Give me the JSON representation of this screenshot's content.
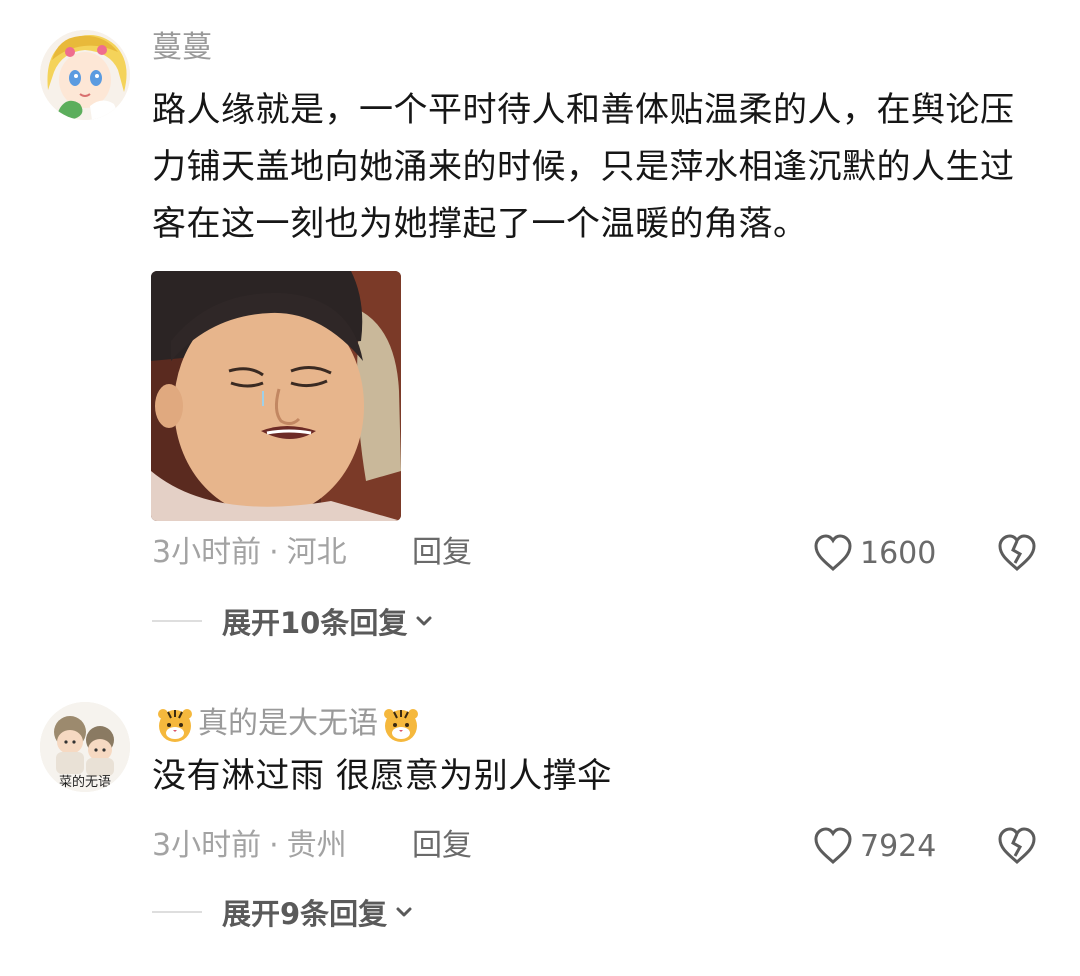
{
  "comments": [
    {
      "username": "蔓蔓",
      "text": "路人缘就是，一个平时待人和善体贴温柔的人，在舆论压力铺天盖地向她涌来的时候，只是萍水相逢沉默的人生过客在这一刻也为她撑起了一个温暖的角落。",
      "time": "3小时前",
      "location": "河北",
      "reply_label": "回复",
      "likes": "1600",
      "expand_label": "展开10条回复",
      "has_image": true
    },
    {
      "username": "真的是大无语",
      "text": "没有淋过雨 很愿意为别人撑伞",
      "avatar_caption": "菜的无语",
      "time": "3小时前",
      "location": "贵州",
      "reply_label": "回复",
      "likes": "7924",
      "expand_label": "展开9条回复",
      "has_image": false
    }
  ],
  "separator": "·",
  "icons": {
    "like": "heart-outline-icon",
    "dislike": "broken-heart-icon",
    "expand": "chevron-down-icon",
    "name_decoration": "tiger-face-emoji"
  },
  "colors": {
    "text_primary": "#161616",
    "text_secondary": "#9a9a9a",
    "action": "#6a6a6a"
  }
}
